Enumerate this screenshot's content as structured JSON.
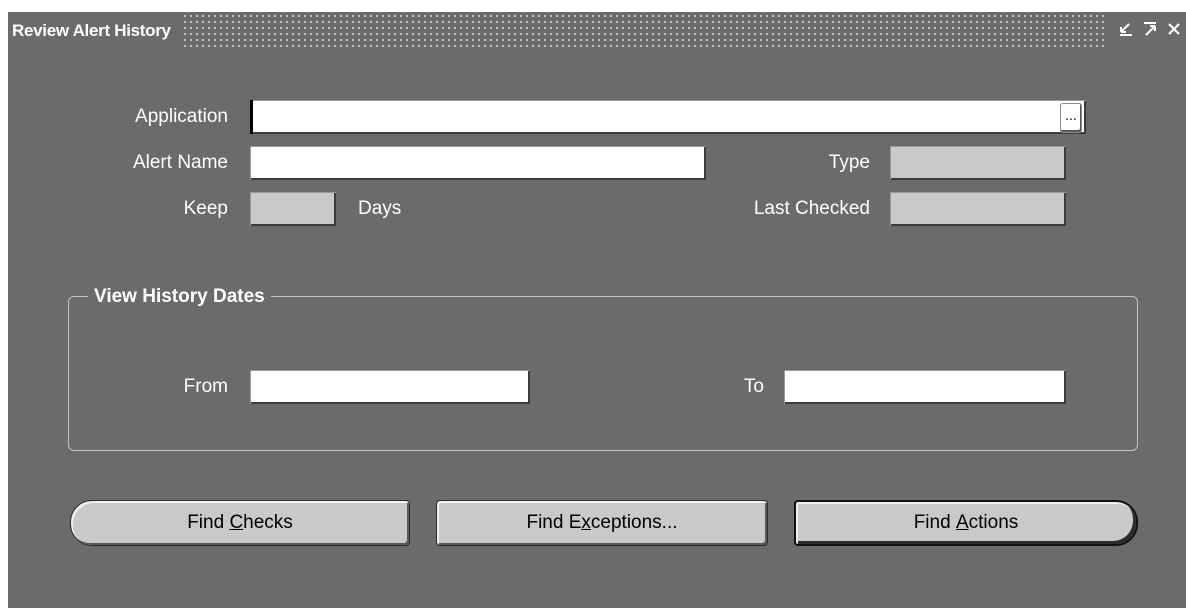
{
  "window": {
    "title": "Review Alert History",
    "controls": [
      "minimize",
      "maximize",
      "close"
    ]
  },
  "form": {
    "application": {
      "label": "Application",
      "value": ""
    },
    "alert_name": {
      "label": "Alert Name",
      "value": ""
    },
    "type": {
      "label": "Type",
      "value": ""
    },
    "keep": {
      "label": "Keep",
      "value": "",
      "unit": "Days"
    },
    "last_checked": {
      "label": "Last Checked",
      "value": ""
    },
    "lov_glyph": "..."
  },
  "history_dates": {
    "title": "View History Dates",
    "from": {
      "label": "From",
      "value": ""
    },
    "to": {
      "label": "To",
      "value": ""
    }
  },
  "buttons": {
    "find_checks": {
      "before": "Find ",
      "mnemonic": "C",
      "after": "hecks"
    },
    "find_exceptions": {
      "before": "Find E",
      "mnemonic": "x",
      "after": "ceptions..."
    },
    "find_actions": {
      "before": "Find ",
      "mnemonic": "A",
      "after": "ctions"
    }
  },
  "icons": {
    "minimize": "minimize-icon",
    "maximize": "maximize-icon",
    "close": "close-icon"
  },
  "colors": {
    "window_bg": "#6b6b6b",
    "readonly_field": "#c9c9c9",
    "button_face": "#c9c9c9"
  }
}
